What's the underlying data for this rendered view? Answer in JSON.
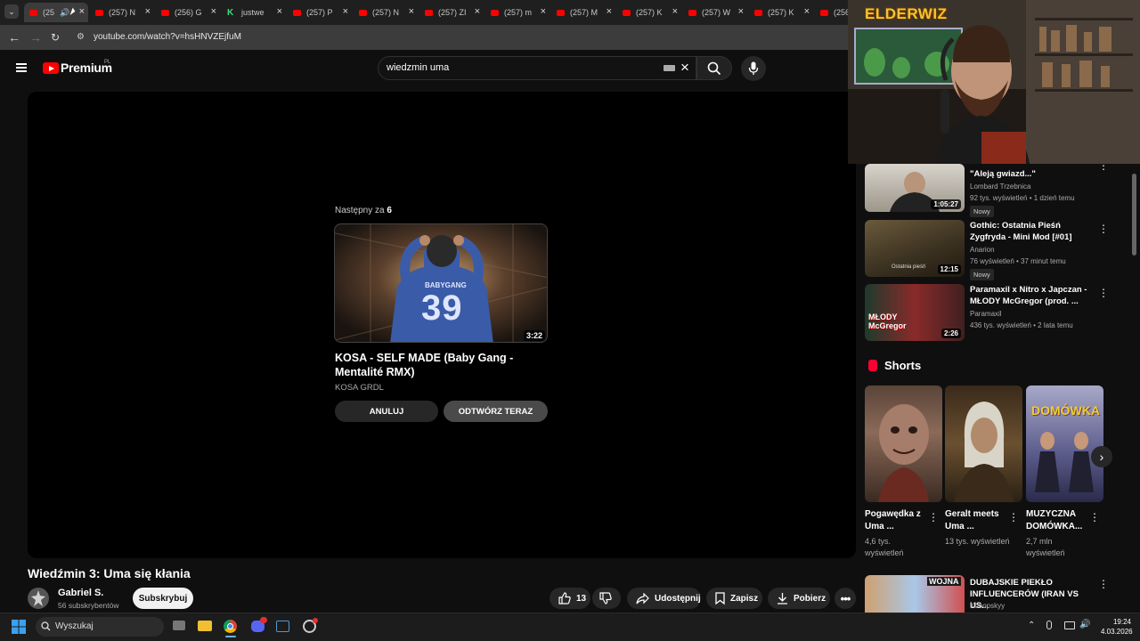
{
  "browser": {
    "tabs": [
      {
        "label": "(25",
        "active": true
      },
      {
        "label": "(257) N"
      },
      {
        "label": "(256) G"
      },
      {
        "label": "justwe"
      },
      {
        "label": "(257) P"
      },
      {
        "label": "(257) N"
      },
      {
        "label": "(257) ZI"
      },
      {
        "label": "(257) m"
      },
      {
        "label": "(257) M"
      },
      {
        "label": "(257) K"
      },
      {
        "label": "(257) W"
      },
      {
        "label": "(257) K"
      },
      {
        "label": "(256"
      }
    ],
    "url": "youtube.com/watch?v=hsHNVZEjfuM"
  },
  "youtube": {
    "brand": "Premium",
    "region": "PL",
    "search_value": "wiedzmin uma"
  },
  "player": {
    "next_prefix": "Następny za",
    "next_count": "6",
    "next_duration": "3:22",
    "next_title": "KOSA - SELF MADE (Baby Gang - Mentalité RMX)",
    "next_channel": "KOSA GRDL",
    "cancel_label": "ANULUJ",
    "play_now_label": "ODTWÓRZ TERAZ",
    "thumb_jersey_name": "BABYGANG",
    "thumb_jersey_number": "39"
  },
  "video": {
    "title": "Wiedźmin 3: Uma się kłania",
    "channel": "Gabriel S.",
    "subscribers": "56 subskrybentów",
    "subscribe_label": "Subskrybuj",
    "likes": "13",
    "share_label": "Udostępnij",
    "save_label": "Zapisz",
    "download_label": "Pobierz"
  },
  "related": [
    {
      "title": "\"Aleją gwiazd...\"",
      "channel": "Lombard Trzebnica",
      "meta": "92 tys. wyświetleń • 1 dzień temu",
      "duration": "1:05:27",
      "badge": "Nowy"
    },
    {
      "title": "Gothic: Ostatnia Pieśń Zygfryda - Mini Mod [#01]",
      "channel": "Anarion",
      "meta": "76 wyświetleń • 37 minut temu",
      "duration": "12:15",
      "badge": "Nowy",
      "thumb_text": "Ostatnia pieśń"
    },
    {
      "title": "Paramaxil x Nitro x Japczan - MŁODY McGregor (prod. ...",
      "channel": "Paramaxil",
      "meta": "436 tys. wyświetleń • 2 lata temu",
      "duration": "2:26",
      "thumb_text": "MŁODY McGregor"
    },
    {
      "title": "DUBAJSKIE PIEKŁO INFLUENCERÓW (IRAN VS US...",
      "channel": "Konopskyy",
      "thumb_text": "WOJNA"
    }
  ],
  "shorts": {
    "heading": "Shorts",
    "items": [
      {
        "title": "Pogawędka z Uma ...",
        "views": "4,6 tys. wyświetleń"
      },
      {
        "title": "Geralt meets Uma ...",
        "views": "13 tys. wyświetleń"
      },
      {
        "title": "MUZYCZNA DOMÓWKA...",
        "views": "2,7 mln wyświetleń",
        "thumb_text": "DOMÓWKA"
      }
    ]
  },
  "overlay": {
    "streamer_logo": "ELDERWIZ"
  },
  "taskbar": {
    "search_label": "Wyszukaj",
    "time": "19:24",
    "date": "4.03.2026"
  }
}
